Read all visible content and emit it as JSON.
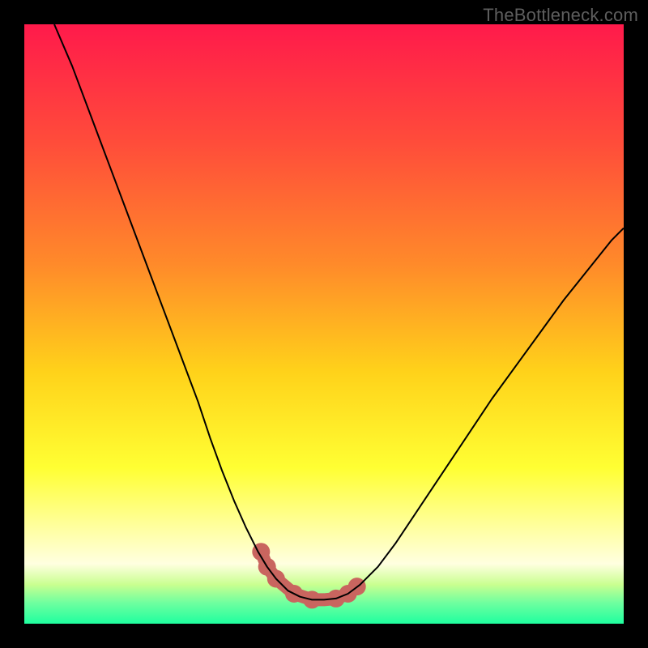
{
  "watermark": {
    "text": "TheBottleneck.com"
  },
  "chart_data": {
    "type": "line",
    "title": "",
    "xlabel": "",
    "ylabel": "",
    "xlim": [
      0,
      1
    ],
    "ylim": [
      0,
      1
    ],
    "background_gradient": {
      "direction": "vertical",
      "stops": [
        {
          "pos": 0.0,
          "color": "#ff1a4b"
        },
        {
          "pos": 0.2,
          "color": "#ff4d3a"
        },
        {
          "pos": 0.4,
          "color": "#ff8a2a"
        },
        {
          "pos": 0.58,
          "color": "#ffd21a"
        },
        {
          "pos": 0.74,
          "color": "#ffff33"
        },
        {
          "pos": 0.84,
          "color": "#ffffa0"
        },
        {
          "pos": 0.9,
          "color": "#ffffe0"
        },
        {
          "pos": 0.935,
          "color": "#c9ff90"
        },
        {
          "pos": 0.965,
          "color": "#6fff9f"
        },
        {
          "pos": 1.0,
          "color": "#1fff9f"
        }
      ]
    },
    "series": [
      {
        "name": "bottleneck-curve",
        "color": "#000000",
        "width": 2,
        "x": [
          0.05,
          0.08,
          0.11,
          0.14,
          0.17,
          0.2,
          0.23,
          0.26,
          0.29,
          0.31,
          0.33,
          0.35,
          0.37,
          0.39,
          0.405,
          0.42,
          0.44,
          0.46,
          0.48,
          0.5,
          0.52,
          0.54,
          0.56,
          0.59,
          0.62,
          0.66,
          0.7,
          0.74,
          0.78,
          0.82,
          0.86,
          0.9,
          0.94,
          0.98,
          1.0
        ],
        "y": [
          1.0,
          0.93,
          0.85,
          0.77,
          0.69,
          0.61,
          0.53,
          0.45,
          0.37,
          0.31,
          0.255,
          0.205,
          0.16,
          0.12,
          0.095,
          0.075,
          0.055,
          0.045,
          0.04,
          0.04,
          0.042,
          0.05,
          0.065,
          0.095,
          0.135,
          0.195,
          0.255,
          0.315,
          0.375,
          0.43,
          0.485,
          0.54,
          0.59,
          0.64,
          0.66
        ]
      },
      {
        "name": "valley-highlight",
        "color": "#c9655f",
        "width": 16,
        "linecap": "round",
        "x": [
          0.395,
          0.405,
          0.42,
          0.45,
          0.48,
          0.5,
          0.52,
          0.54,
          0.555
        ],
        "y": [
          0.12,
          0.095,
          0.075,
          0.05,
          0.04,
          0.04,
          0.042,
          0.05,
          0.062
        ]
      }
    ],
    "markers": {
      "name": "valley-dots",
      "color": "#c9655f",
      "radius": 11,
      "x": [
        0.395,
        0.405,
        0.42,
        0.45,
        0.48,
        0.52,
        0.54,
        0.555
      ],
      "y": [
        0.12,
        0.095,
        0.075,
        0.05,
        0.04,
        0.042,
        0.05,
        0.062
      ]
    }
  }
}
